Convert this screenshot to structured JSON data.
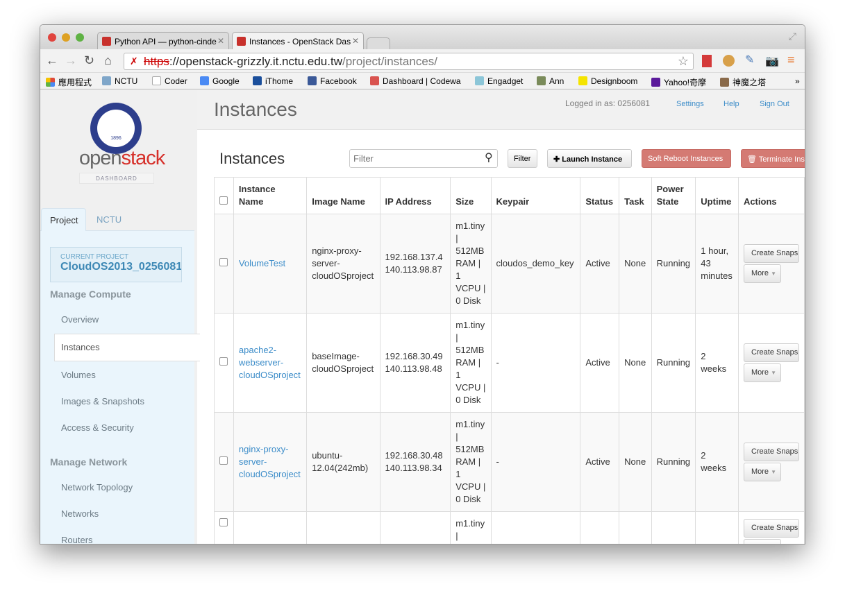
{
  "browser": {
    "tabs": [
      {
        "title": "Python API — python-cinde"
      },
      {
        "title": "Instances - OpenStack Das"
      }
    ],
    "url_scheme": "https",
    "url_host": "://openstack-grizzly.it.nctu.edu.tw",
    "url_path": "/project/instances/",
    "bookmarks": [
      {
        "label": "應用程式",
        "color": "#e04a3a"
      },
      {
        "label": "NCTU",
        "color": "#7fa6c9"
      },
      {
        "label": "Coder",
        "color": "#eeeeee"
      },
      {
        "label": "Google",
        "color": "#4a8af4"
      },
      {
        "label": "iThome",
        "color": "#1b4f9c"
      },
      {
        "label": "Facebook",
        "color": "#3b5998"
      },
      {
        "label": "Dashboard | Codewa",
        "color": "#d9534f"
      },
      {
        "label": "Engadget",
        "color": "#8cc6d8"
      },
      {
        "label": "Ann",
        "color": "#7a8b5a"
      },
      {
        "label": "Designboom",
        "color": "#f5e400"
      },
      {
        "label": "Yahoo!奇摩",
        "color": "#5b1a9b"
      },
      {
        "label": "神魔之塔",
        "color": "#8a6a4a"
      }
    ],
    "more": "»"
  },
  "sidebar": {
    "brand_a": "open",
    "brand_b": "stack",
    "brand_sub": "DASHBOARD",
    "logo_year": "1896",
    "tabs": [
      "Project",
      "NCTU"
    ],
    "current_project_label": "CURRENT PROJECT",
    "current_project": "CloudOS2013_0256081",
    "sections": [
      {
        "title": "Manage Compute",
        "items": [
          "Overview",
          "Instances",
          "Volumes",
          "Images & Snapshots",
          "Access & Security"
        ]
      },
      {
        "title": "Manage Network",
        "items": [
          "Network Topology",
          "Networks",
          "Routers"
        ]
      }
    ],
    "active": "Instances"
  },
  "header": {
    "title": "Instances",
    "logged_in": "Logged in as: 0256081",
    "links": [
      "Settings",
      "Help",
      "Sign Out"
    ]
  },
  "toolbar": {
    "title": "Instances",
    "filter_placeholder": "Filter",
    "filter_btn": "Filter",
    "launch": "Launch Instance",
    "soft_reboot": "Soft Reboot Instances",
    "terminate": "Terminate Instances"
  },
  "table": {
    "columns": [
      "Instance Name",
      "Image Name",
      "IP Address",
      "Size",
      "Keypair",
      "Status",
      "Task",
      "Power State",
      "Uptime",
      "Actions"
    ],
    "rows": [
      {
        "name": "VolumeTest",
        "image": "nginx-proxy-server-cloudOSproject",
        "ip1": "192.168.137.4",
        "ip2": "140.113.98.87",
        "size": "m1.tiny | 512MB RAM | 1 VCPU | 0 Disk",
        "keypair": "cloudos_demo_key",
        "status": "Active",
        "task": "None",
        "power": "Running",
        "uptime": "1 hour, 43 minutes"
      },
      {
        "name": "apache2-webserver-cloudOSproject",
        "image": "baseImage-cloudOSproject",
        "ip1": "192.168.30.49",
        "ip2": "140.113.98.48",
        "size": "m1.tiny | 512MB RAM | 1 VCPU | 0 Disk",
        "keypair": "-",
        "status": "Active",
        "task": "None",
        "power": "Running",
        "uptime": "2 weeks"
      },
      {
        "name": "nginx-proxy-server-cloudOSproject",
        "image": "ubuntu-12.04(242mb)",
        "ip1": "192.168.30.48",
        "ip2": "140.113.98.34",
        "size": "m1.tiny | 512MB RAM | 1 VCPU | 0 Disk",
        "keypair": "-",
        "status": "Active",
        "task": "None",
        "power": "Running",
        "uptime": "2 weeks"
      },
      {
        "name": "",
        "image": "",
        "ip1": "",
        "ip2": "",
        "size": "m1.tiny |",
        "keypair": "",
        "status": "",
        "task": "",
        "power": "",
        "uptime": ""
      }
    ],
    "actions": {
      "snapshot": "Create Snapshot",
      "more": "More"
    }
  }
}
